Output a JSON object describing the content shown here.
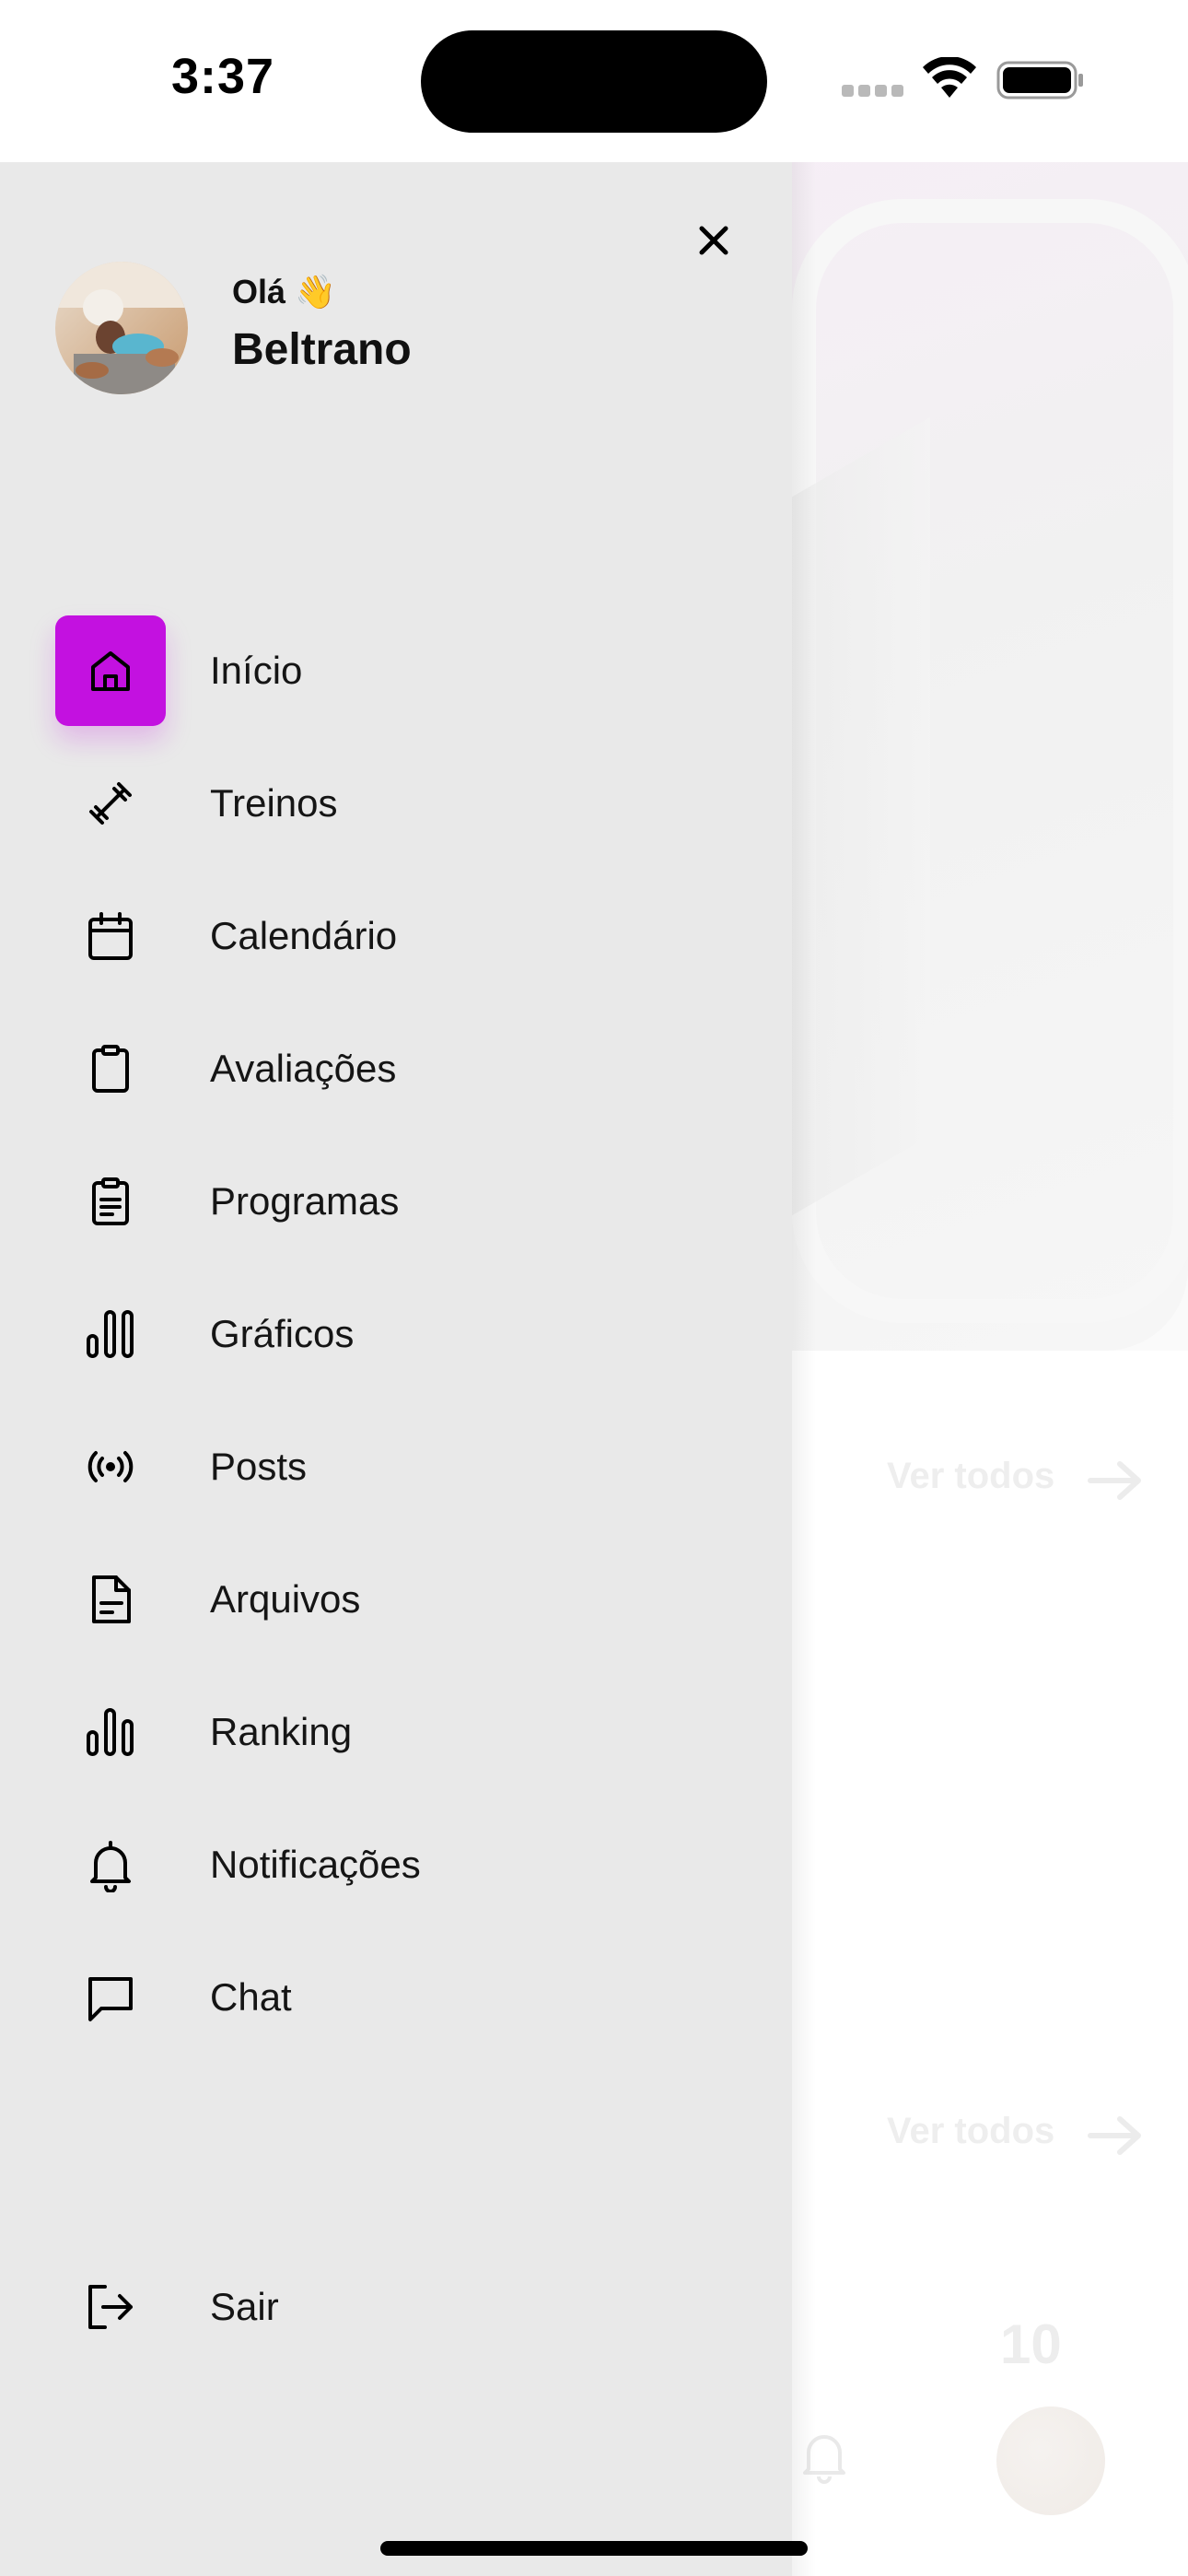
{
  "status_bar": {
    "time": "3:37",
    "icons": [
      "cellular-signal-icon",
      "wifi-icon",
      "battery-icon"
    ]
  },
  "background": {
    "links": [
      "Ver todos",
      "Ver todos"
    ],
    "partial_number": "10"
  },
  "drawer": {
    "greeting": "Olá 👋",
    "user_name": "Beltrano",
    "accent_color": "#c311e0",
    "menu": [
      {
        "label": "Início",
        "icon": "home-icon",
        "active": true
      },
      {
        "label": "Treinos",
        "icon": "dumbbell-icon",
        "active": false
      },
      {
        "label": "Calendário",
        "icon": "calendar-icon",
        "active": false
      },
      {
        "label": "Avaliações",
        "icon": "clipboard-icon",
        "active": false
      },
      {
        "label": "Programas",
        "icon": "clipboard-list-icon",
        "active": false
      },
      {
        "label": "Gráficos",
        "icon": "bar-chart-icon",
        "active": false
      },
      {
        "label": "Posts",
        "icon": "broadcast-icon",
        "active": false
      },
      {
        "label": "Arquivos",
        "icon": "file-icon",
        "active": false
      },
      {
        "label": "Ranking",
        "icon": "ranking-icon",
        "active": false
      },
      {
        "label": "Notificações",
        "icon": "bell-icon",
        "active": false
      },
      {
        "label": "Chat",
        "icon": "chat-icon",
        "active": false
      }
    ],
    "logout": {
      "label": "Sair",
      "icon": "logout-icon"
    }
  }
}
